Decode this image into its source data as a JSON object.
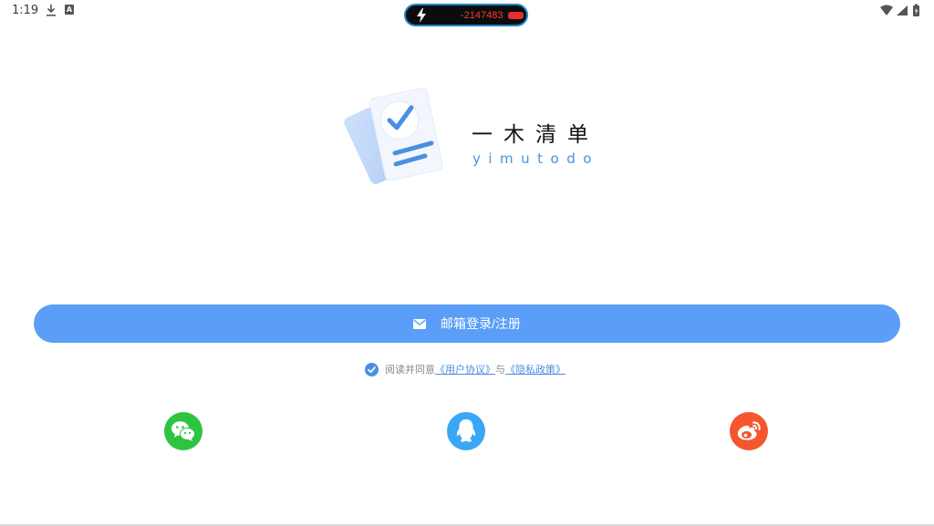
{
  "status_bar": {
    "time": "1:19",
    "notification_badge": "A",
    "pill_value": "-2147483"
  },
  "app": {
    "name": "一木清单",
    "subtitle": "yimutodo"
  },
  "login": {
    "email_button_label": "邮箱登录/注册"
  },
  "agreement": {
    "prefix": "阅读并同意",
    "user_agreement": "《用户协议》",
    "connector": "与",
    "privacy_policy": "《隐私政策》"
  },
  "social": {
    "wechat": "wechat-icon",
    "qq": "qq-icon",
    "weibo": "weibo-icon"
  },
  "colors": {
    "primary": "#5a9ef7",
    "accent_text": "#4a8fe0",
    "wechat": "#2dc441",
    "qq": "#3aa7f6",
    "weibo": "#f4562e"
  }
}
